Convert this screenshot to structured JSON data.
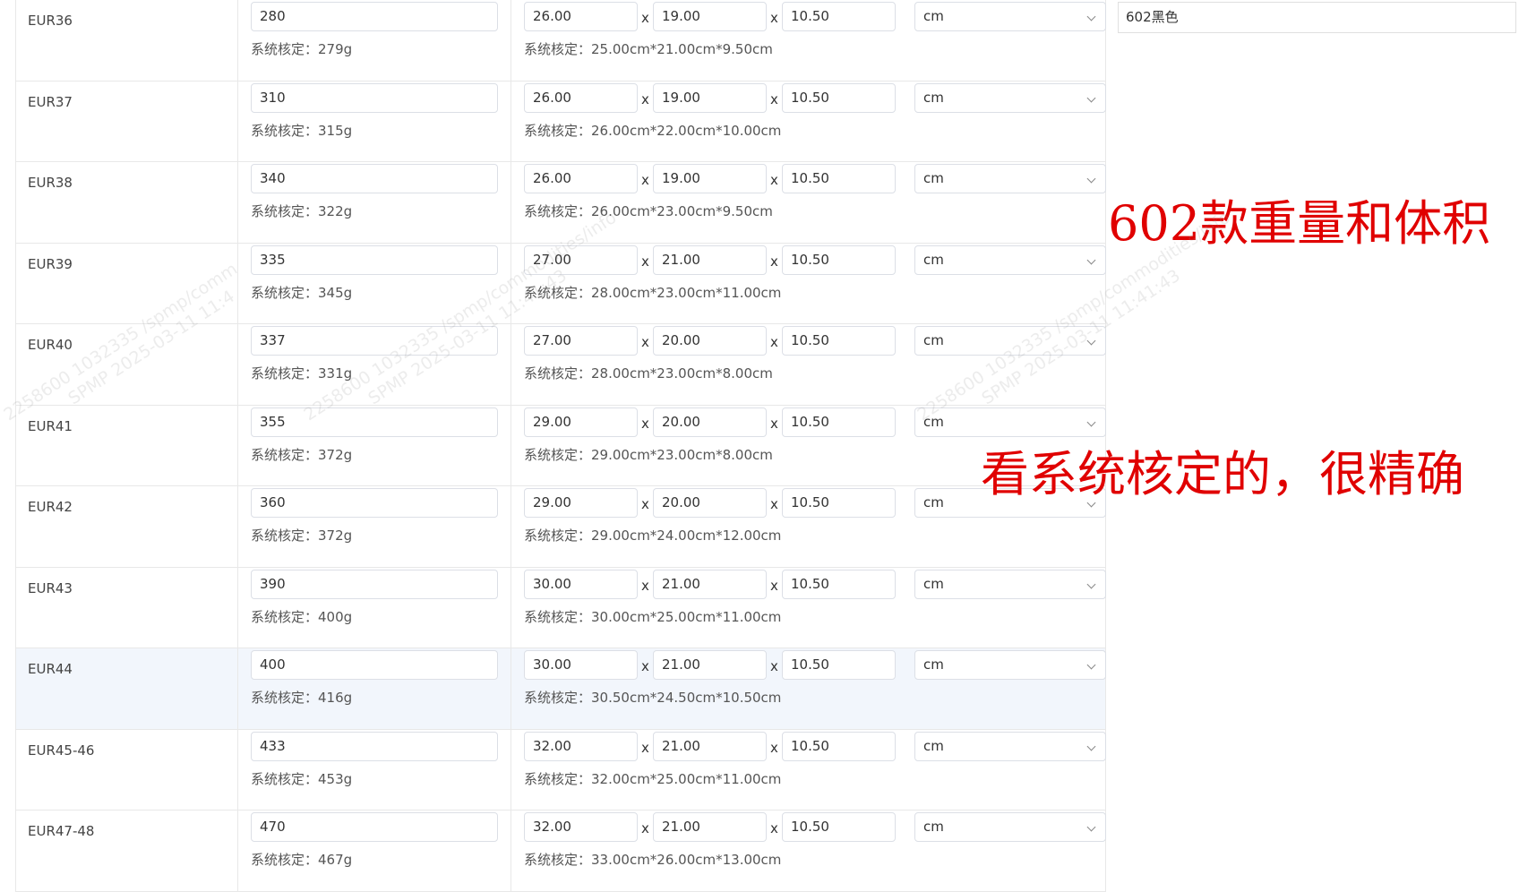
{
  "rows": [
    {
      "size": "EUR36",
      "weight": "280",
      "weight_note": "系统核定：279g",
      "dims": [
        "26.00",
        "19.00",
        "10.50"
      ],
      "unit": "cm",
      "dims_note": "系统核定：25.00cm*21.00cm*9.50cm"
    },
    {
      "size": "EUR37",
      "weight": "310",
      "weight_note": "系统核定：315g",
      "dims": [
        "26.00",
        "19.00",
        "10.50"
      ],
      "unit": "cm",
      "dims_note": "系统核定：26.00cm*22.00cm*10.00cm"
    },
    {
      "size": "EUR38",
      "weight": "340",
      "weight_note": "系统核定：322g",
      "dims": [
        "26.00",
        "19.00",
        "10.50"
      ],
      "unit": "cm",
      "dims_note": "系统核定：26.00cm*23.00cm*9.50cm"
    },
    {
      "size": "EUR39",
      "weight": "335",
      "weight_note": "系统核定：345g",
      "dims": [
        "27.00",
        "21.00",
        "10.50"
      ],
      "unit": "cm",
      "dims_note": "系统核定：28.00cm*23.00cm*11.00cm"
    },
    {
      "size": "EUR40",
      "weight": "337",
      "weight_note": "系统核定：331g",
      "dims": [
        "27.00",
        "20.00",
        "10.50"
      ],
      "unit": "cm",
      "dims_note": "系统核定：28.00cm*23.00cm*8.00cm"
    },
    {
      "size": "EUR41",
      "weight": "355",
      "weight_note": "系统核定：372g",
      "dims": [
        "29.00",
        "20.00",
        "10.50"
      ],
      "unit": "cm",
      "dims_note": "系统核定：29.00cm*23.00cm*8.00cm"
    },
    {
      "size": "EUR42",
      "weight": "360",
      "weight_note": "系统核定：372g",
      "dims": [
        "29.00",
        "20.00",
        "10.50"
      ],
      "unit": "cm",
      "dims_note": "系统核定：29.00cm*24.00cm*12.00cm"
    },
    {
      "size": "EUR43",
      "weight": "390",
      "weight_note": "系统核定：400g",
      "dims": [
        "30.00",
        "21.00",
        "10.50"
      ],
      "unit": "cm",
      "dims_note": "系统核定：30.00cm*25.00cm*11.00cm"
    },
    {
      "size": "EUR44",
      "weight": "400",
      "weight_note": "系统核定：416g",
      "dims": [
        "30.00",
        "21.00",
        "10.50"
      ],
      "unit": "cm",
      "dims_note": "系统核定：30.50cm*24.50cm*10.50cm",
      "highlighted": true
    },
    {
      "size": "EUR45-46",
      "weight": "433",
      "weight_note": "系统核定：453g",
      "dims": [
        "32.00",
        "21.00",
        "10.50"
      ],
      "unit": "cm",
      "dims_note": "系统核定：32.00cm*25.00cm*11.00cm"
    },
    {
      "size": "EUR47-48",
      "weight": "470",
      "weight_note": "系统核定：467g",
      "dims": [
        "32.00",
        "21.00",
        "10.50"
      ],
      "unit": "cm",
      "dims_note": "系统核定：33.00cm*26.00cm*13.00cm"
    }
  ],
  "dim_separator": "x",
  "color_value": "602黑色",
  "annotations": {
    "line1": "602款重量和体积",
    "line2": "看系统核定的，很精确"
  },
  "watermarks": [
    {
      "line1": "2258600 1032335 /spmp/comm",
      "line2": "SPMP 2025-03-11 11:4"
    },
    {
      "line1": "2258600 1032335 /spmp/commodities/info",
      "line2": "SPMP 2025-03-11 11:41:43"
    },
    {
      "line1": "2258600 1032335 /spmp/commodities/info",
      "line2": "SPMP 2025-03-11 11:41:43"
    }
  ],
  "colors": {
    "annotation": "#e00000",
    "border": "#e8e8e8",
    "highlight_row": "#f2f6fc"
  }
}
